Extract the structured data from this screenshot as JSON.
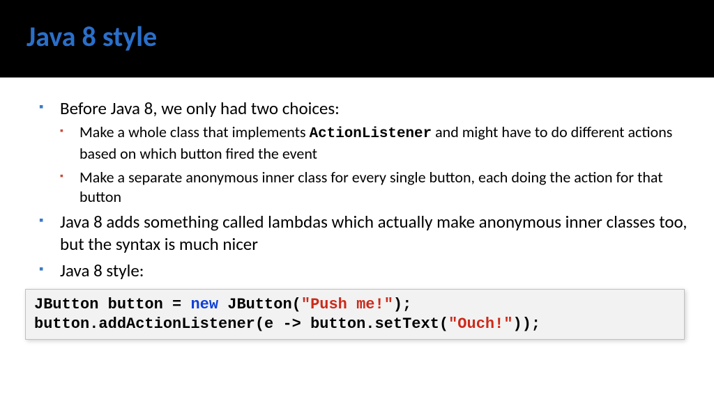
{
  "title": "Java 8 style",
  "bullets": {
    "b1": "Before Java 8, we only had two choices:",
    "b1a_pre": "Make a whole class that implements ",
    "b1a_code": "ActionListener",
    "b1a_post": " and might have to do different actions based on which button fired the event",
    "b1b": "Make a separate anonymous inner class for every single button, each doing the action for that button",
    "b2": "Java 8 adds something called lambdas which actually make anonymous inner classes too, but the syntax is much nicer",
    "b3": "Java 8 style:"
  },
  "code": {
    "l1_a": "JButton button = ",
    "l1_kw": "new",
    "l1_b": " JButton(",
    "l1_str": "\"Push me!\"",
    "l1_c": ");",
    "l2_a": "button.addActionListener(e -> button.setText(",
    "l2_str": "\"Ouch!\"",
    "l2_b": "));"
  }
}
